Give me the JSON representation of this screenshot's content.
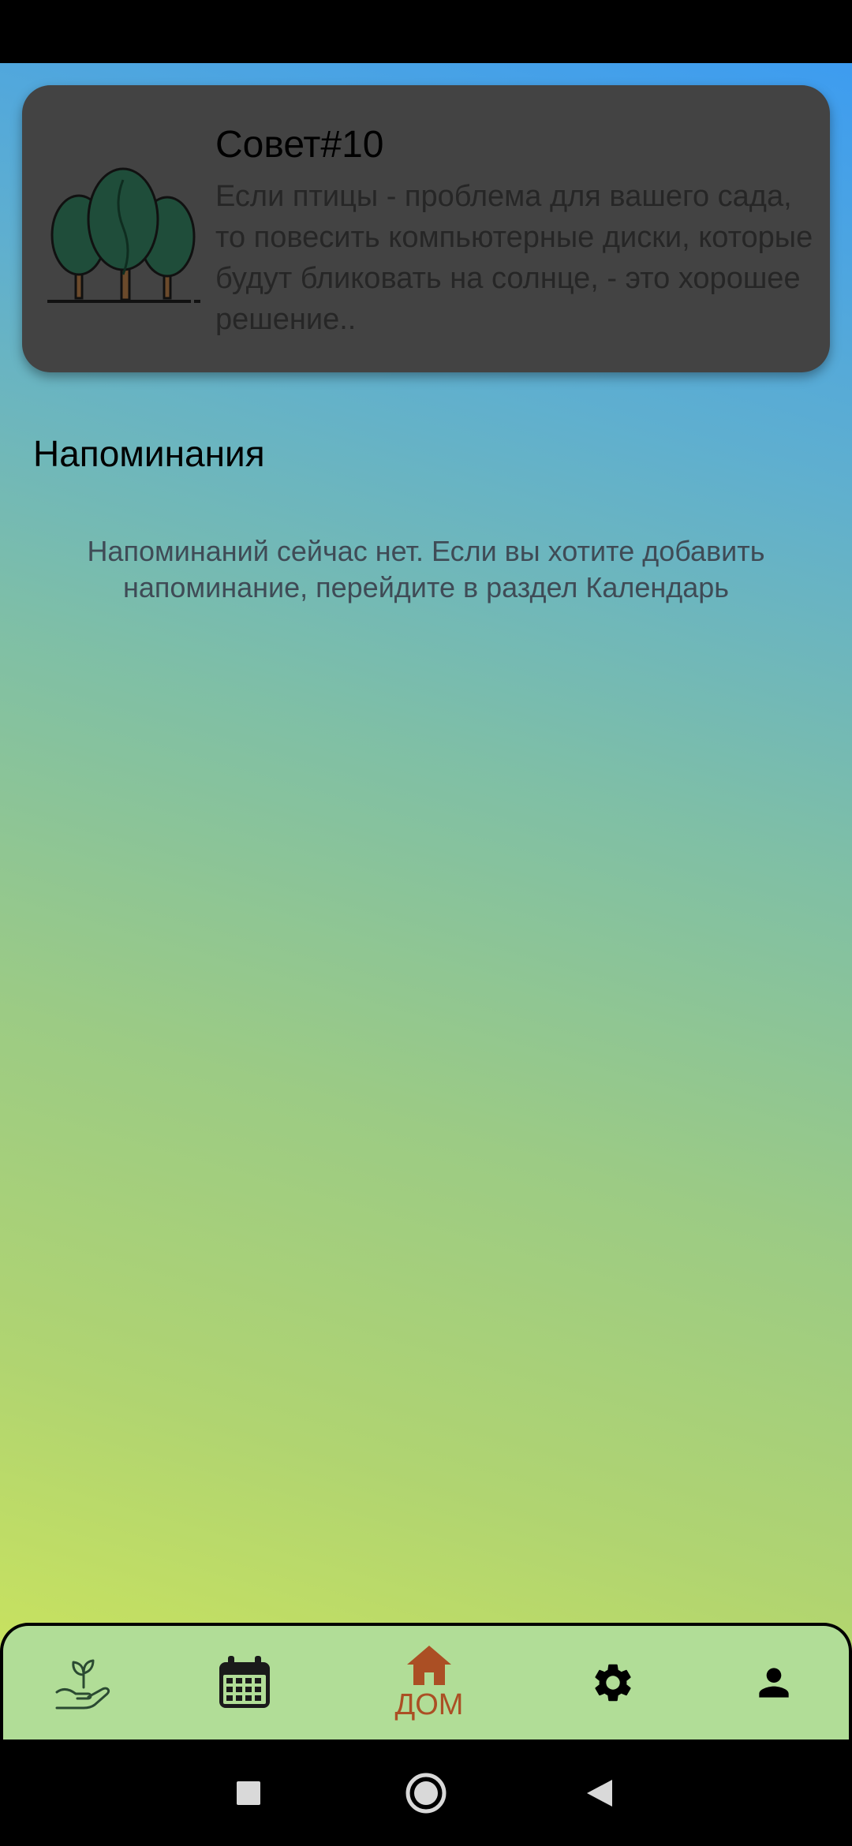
{
  "tip": {
    "title": "Совет#10",
    "text": "Если птицы - проблема для вашего сада, то повесить компьютерные диски, которые будут бликовать на солнце, - это хорошее решение..",
    "icon": "trees-icon"
  },
  "reminders": {
    "title": "Напоминания",
    "empty_message": "Напоминаний сейчас нет. Если вы хотите добавить напоминание, перейдите в раздел Календарь"
  },
  "bottom_nav": {
    "items": [
      {
        "icon": "plant-hand-icon",
        "label": ""
      },
      {
        "icon": "calendar-icon",
        "label": ""
      },
      {
        "icon": "home-icon",
        "label": "ДОМ",
        "active": true
      },
      {
        "icon": "gear-icon",
        "label": ""
      },
      {
        "icon": "person-icon",
        "label": ""
      }
    ]
  },
  "colors": {
    "accent": "#ab4f24",
    "nav_background": "#b1dd97",
    "card_background": "#434343",
    "gradient_top": "#3d9cf0",
    "gradient_bottom": "#cfe65a"
  }
}
